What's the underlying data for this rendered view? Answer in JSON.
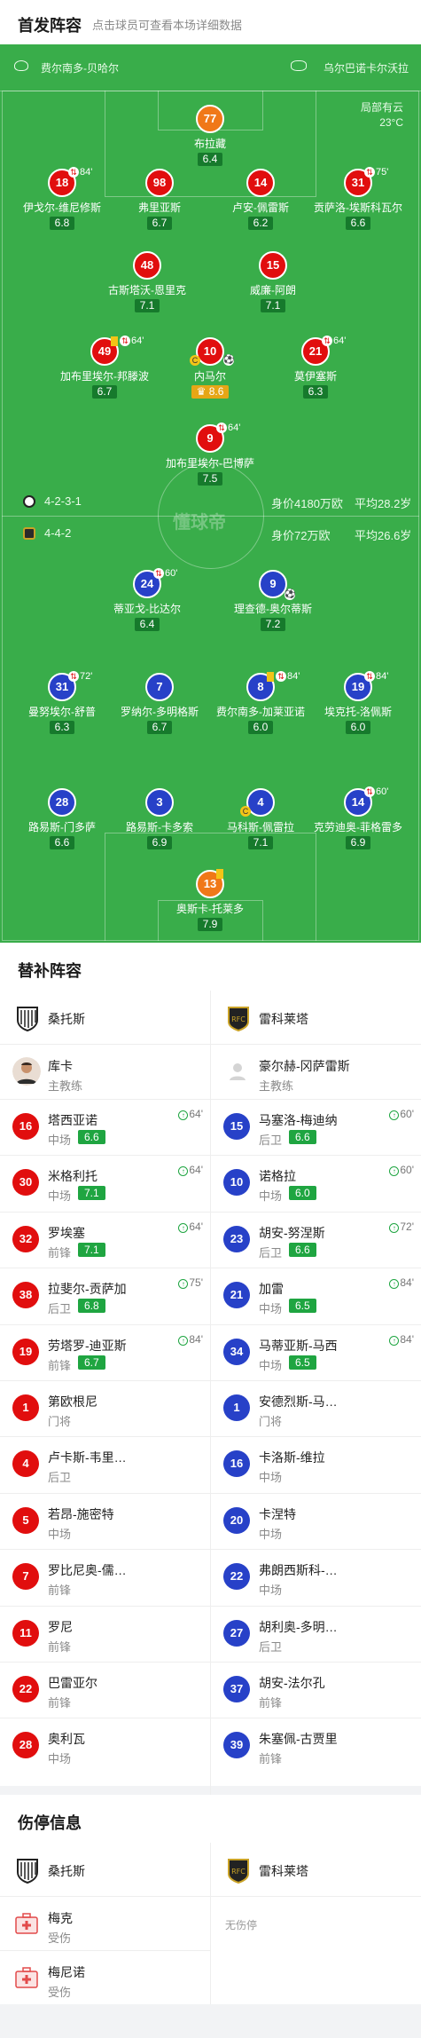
{
  "header": {
    "title": "首发阵容",
    "subtitle": "点击球员可查看本场详细数据"
  },
  "teams": {
    "home": "费尔南多-贝哈尔",
    "away": "乌尔巴诺卡尔沃拉"
  },
  "weather": {
    "condition": "局部有云",
    "temp": "23°C"
  },
  "home_info": {
    "formation": "4-2-3-1",
    "value": "身价4180万欧",
    "age": "平均28.2岁"
  },
  "away_info": {
    "formation": "4-4-2",
    "value": "身价72万欧",
    "age": "平均26.6岁"
  },
  "center_logo": "懂球帝",
  "home_players": [
    {
      "num": "77",
      "name": "布拉藏",
      "rating": "6.4",
      "kind": "gk"
    },
    {
      "num": "18",
      "name": "伊戈尔-维尼修斯",
      "rating": "6.8",
      "sub": "84'"
    },
    {
      "num": "98",
      "name": "弗里亚斯",
      "rating": "6.7"
    },
    {
      "num": "14",
      "name": "卢安-佩雷斯",
      "rating": "6.2"
    },
    {
      "num": "31",
      "name": "贡萨洛-埃斯科瓦尔",
      "rating": "6.6",
      "sub": "75'"
    },
    {
      "num": "48",
      "name": "古斯塔沃-恩里克",
      "rating": "7.1"
    },
    {
      "num": "15",
      "name": "威廉-阿朗",
      "rating": "7.1"
    },
    {
      "num": "49",
      "name": "加布里埃尔-邦滕波",
      "rating": "6.7",
      "sub": "64'"
    },
    {
      "num": "10",
      "name": "内马尔",
      "rating": "8.6",
      "best": true
    },
    {
      "num": "21",
      "name": "莫伊塞斯",
      "rating": "6.3",
      "sub": "64'"
    },
    {
      "num": "9",
      "name": "加布里埃尔-巴博萨",
      "rating": "7.5",
      "sub": "64'"
    }
  ],
  "away_players": [
    {
      "num": "24",
      "name": "蒂亚戈-比达尔",
      "rating": "6.4",
      "sub": "60'"
    },
    {
      "num": "9",
      "name": "理查德-奥尔蒂斯",
      "rating": "7.2"
    },
    {
      "num": "31",
      "name": "曼努埃尔-舒普",
      "rating": "6.3",
      "sub": "72'"
    },
    {
      "num": "7",
      "name": "罗纳尔-多明格斯",
      "rating": "6.7"
    },
    {
      "num": "8",
      "name": "费尔南多-加莱亚诺",
      "rating": "6.0",
      "sub": "84'"
    },
    {
      "num": "19",
      "name": "埃克托-洛佩斯",
      "rating": "6.0",
      "sub": "84'"
    },
    {
      "num": "28",
      "name": "路易斯-门多萨",
      "rating": "6.6"
    },
    {
      "num": "3",
      "name": "路易斯-卡多索",
      "rating": "6.9"
    },
    {
      "num": "4",
      "name": "马科斯-佩雷拉",
      "rating": "7.1"
    },
    {
      "num": "14",
      "name": "克劳迪奥-菲格雷多",
      "rating": "6.9",
      "sub": "60'"
    },
    {
      "num": "13",
      "name": "奥斯卡-托莱多",
      "rating": "7.9",
      "kind": "gk"
    }
  ],
  "subs": {
    "title": "替补阵容",
    "home_team": "桑托斯",
    "away_team": "雷科莱塔",
    "home_coach": {
      "name": "库卡",
      "role": "主教练"
    },
    "away_coach": {
      "name": "豪尔赫-冈萨雷斯",
      "role": "主教练"
    },
    "home": [
      {
        "num": "16",
        "name": "塔西亚诺",
        "pos": "中场",
        "rating": "6.6",
        "min": "64'"
      },
      {
        "num": "30",
        "name": "米格利托",
        "pos": "中场",
        "rating": "7.1",
        "min": "64'"
      },
      {
        "num": "32",
        "name": "罗埃塞",
        "pos": "前锋",
        "rating": "7.1",
        "min": "64'"
      },
      {
        "num": "38",
        "name": "拉斐尔-贡萨加",
        "pos": "后卫",
        "rating": "6.8",
        "min": "75'"
      },
      {
        "num": "19",
        "name": "劳塔罗-迪亚斯",
        "pos": "前锋",
        "rating": "6.7",
        "min": "84'"
      },
      {
        "num": "1",
        "name": "第欧根尼",
        "pos": "门将"
      },
      {
        "num": "4",
        "name": "卢卡斯-韦里…",
        "pos": "后卫"
      },
      {
        "num": "5",
        "name": "若昂-施密特",
        "pos": "中场"
      },
      {
        "num": "7",
        "name": "罗比尼奥-儒…",
        "pos": "前锋"
      },
      {
        "num": "11",
        "name": "罗尼",
        "pos": "前锋"
      },
      {
        "num": "22",
        "name": "巴雷亚尔",
        "pos": "前锋"
      },
      {
        "num": "28",
        "name": "奥利瓦",
        "pos": "中场"
      }
    ],
    "away": [
      {
        "num": "15",
        "name": "马塞洛-梅迪纳",
        "pos": "后卫",
        "rating": "6.6",
        "min": "60'"
      },
      {
        "num": "10",
        "name": "诺格拉",
        "pos": "中场",
        "rating": "6.0",
        "min": "60'"
      },
      {
        "num": "23",
        "name": "胡安-努涅斯",
        "pos": "后卫",
        "rating": "6.6",
        "min": "72'"
      },
      {
        "num": "21",
        "name": "加雷",
        "pos": "中场",
        "rating": "6.5",
        "min": "84'"
      },
      {
        "num": "34",
        "name": "马蒂亚斯-马西",
        "pos": "中场",
        "rating": "6.5",
        "min": "84'"
      },
      {
        "num": "1",
        "name": "安德烈斯-马…",
        "pos": "门将"
      },
      {
        "num": "16",
        "name": "卡洛斯-维拉",
        "pos": "中场"
      },
      {
        "num": "20",
        "name": "卡涅特",
        "pos": "中场"
      },
      {
        "num": "22",
        "name": "弗朗西斯科-…",
        "pos": "中场"
      },
      {
        "num": "27",
        "name": "胡利奥-多明…",
        "pos": "后卫"
      },
      {
        "num": "37",
        "name": "胡安-法尔孔",
        "pos": "前锋"
      },
      {
        "num": "39",
        "name": "朱塞佩-古贾里",
        "pos": "前锋"
      }
    ]
  },
  "injuries": {
    "title": "伤停信息",
    "home": [
      {
        "name": "梅克",
        "status": "受伤"
      },
      {
        "name": "梅尼诺",
        "status": "受伤"
      }
    ],
    "away_empty": "无伤停"
  },
  "colors": {
    "pitch": "#39ad4a",
    "home": "#e10e0e",
    "away": "#2741c8",
    "gk": "#f07818",
    "rating_bg": "#1fa541"
  }
}
